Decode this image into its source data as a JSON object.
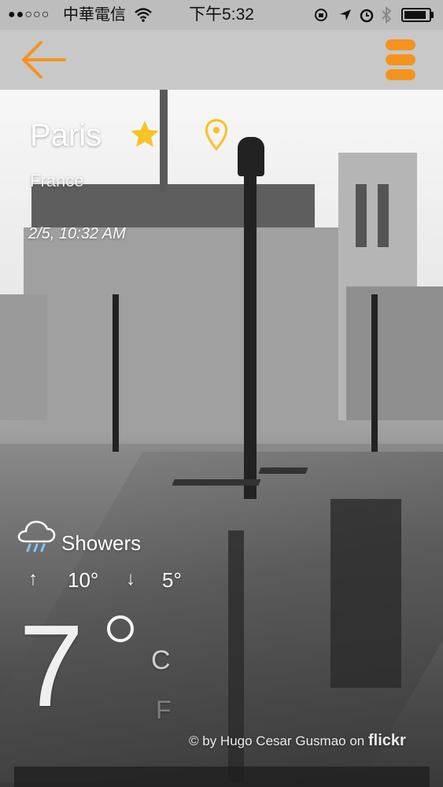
{
  "status_bar": {
    "signal_dots": "●●○○○",
    "carrier": "中華電信",
    "wifi_icon": "wifi-icon",
    "time": "下午5:32",
    "battery_level": 0.9
  },
  "nav": {
    "back_icon": "arrow-left-icon",
    "menu_icon": "menu-icon",
    "accent": "#f4941e"
  },
  "location": {
    "city": "Paris",
    "country": "France",
    "datetime": "2/5, 10:32 AM"
  },
  "weather": {
    "condition": "Showers",
    "high": "10°",
    "low": "5°",
    "temperature": "7",
    "unit_celsius": "C",
    "unit_fahrenheit": "F"
  },
  "photo_credit": {
    "text": "© by Hugo Cesar Gusmao on",
    "source": "flickr"
  },
  "colors": {
    "star": "#f7c325",
    "pin": "#f7c325"
  }
}
